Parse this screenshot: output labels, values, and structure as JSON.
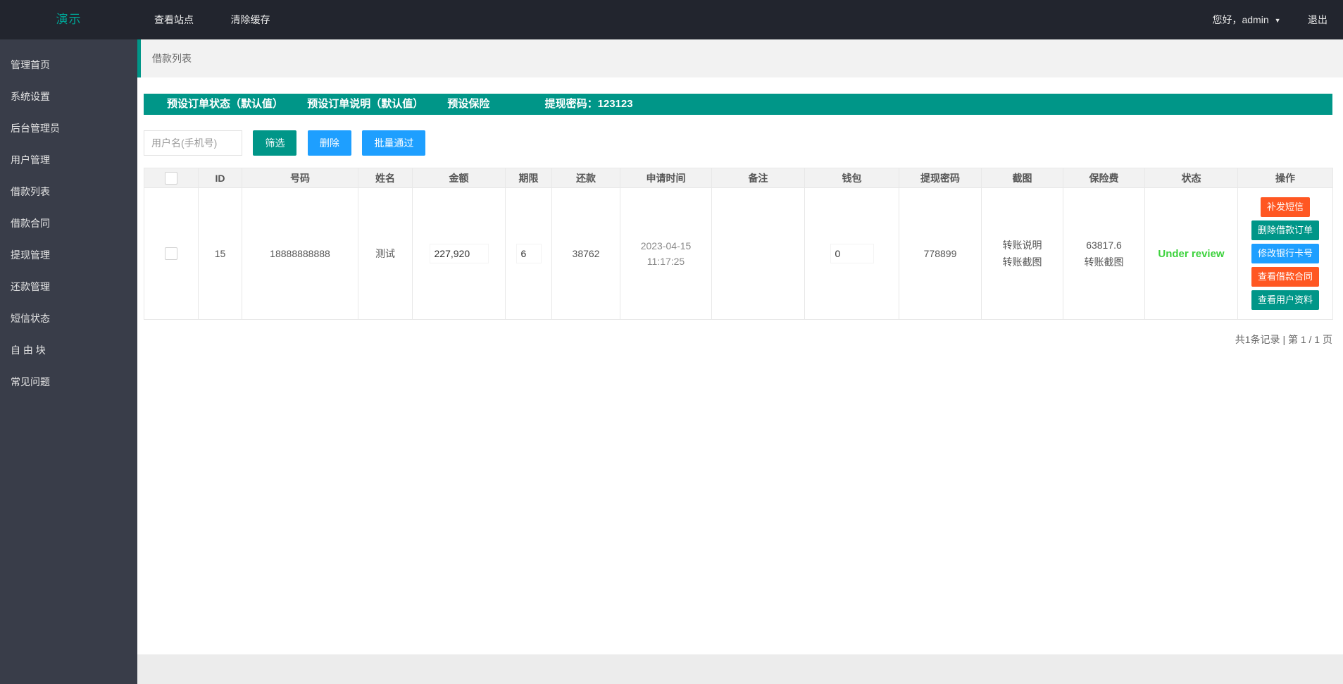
{
  "header": {
    "logo": "演示",
    "nav": [
      "查看站点",
      "清除缓存"
    ],
    "greeting": "您好，admin",
    "logout": "退出"
  },
  "sidebar": {
    "items": [
      "管理首页",
      "系统设置",
      "后台管理员",
      "用户管理",
      "借款列表",
      "借款合同",
      "提现管理",
      "还款管理",
      "短信状态",
      "自 由 块",
      "常见问题"
    ]
  },
  "breadcrumb": "借款列表",
  "banner": {
    "items": [
      "预设订单状态（默认值）",
      "预设订单说明（默认值）",
      "预设保险",
      "提现密码：123123"
    ]
  },
  "filter": {
    "placeholder": "用户名(手机号)",
    "filter_btn": "筛选",
    "delete_btn": "删除",
    "batch_btn": "批量通过"
  },
  "table": {
    "headers": [
      "ID",
      "号码",
      "姓名",
      "金额",
      "期限",
      "还款",
      "申请时间",
      "备注",
      "钱包",
      "提现密码",
      "截图",
      "保险费",
      "状态",
      "操作"
    ],
    "row": {
      "id": "15",
      "phone": "18888888888",
      "name": "测试",
      "amount": "227,920",
      "term": "6",
      "repayment": "38762",
      "apply_date": "2023-04-15",
      "apply_time": "11:17:25",
      "remark": "",
      "wallet": "0",
      "withdraw_password": "778899",
      "screenshot_line1": "转账说明",
      "screenshot_line2": "转账截图",
      "insurance_fee": "63817.6",
      "insurance_line2": "转账截图",
      "status": "Under review",
      "actions": [
        {
          "label": "补发短信",
          "color": "#ff5722"
        },
        {
          "label": "删除借款订单",
          "color": "#009688"
        },
        {
          "label": "修改银行卡号",
          "color": "#1e9fff"
        },
        {
          "label": "查看借款合同",
          "color": "#ff5722"
        },
        {
          "label": "查看用户资料",
          "color": "#009688"
        }
      ]
    }
  },
  "pagination": "共1条记录 | 第 1 / 1 页",
  "colors": {
    "topbar_bg": "#22252e",
    "sidebar_bg": "#393d49",
    "accent_teal": "#009688",
    "accent_blue": "#1e9fff",
    "accent_orange": "#ff5722",
    "status_green": "#3dd23d",
    "logo_teal": "#00a294"
  }
}
